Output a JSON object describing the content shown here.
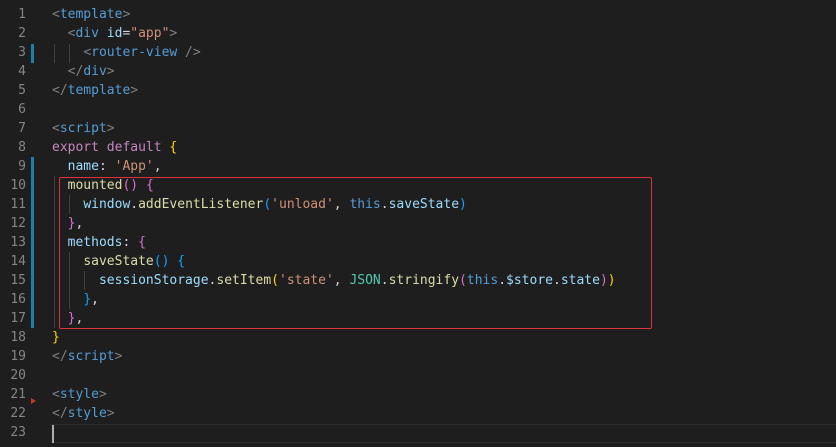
{
  "editor": {
    "lines": [
      {
        "n": "1",
        "tokens": [
          {
            "t": "<",
            "c": "#808080"
          },
          {
            "t": "template",
            "c": "#569cd6"
          },
          {
            "t": ">",
            "c": "#808080"
          }
        ]
      },
      {
        "n": "2",
        "tokens": [
          {
            "t": "  ",
            "c": "#d4d4d4"
          },
          {
            "t": "<",
            "c": "#808080"
          },
          {
            "t": "div",
            "c": "#569cd6"
          },
          {
            "t": " ",
            "c": "#d4d4d4"
          },
          {
            "t": "id",
            "c": "#9cdcfe"
          },
          {
            "t": "=",
            "c": "#d4d4d4"
          },
          {
            "t": "\"app\"",
            "c": "#ce9178"
          },
          {
            "t": ">",
            "c": "#808080"
          }
        ]
      },
      {
        "n": "3",
        "tokens": [
          {
            "t": "    ",
            "c": "#d4d4d4"
          },
          {
            "t": "<",
            "c": "#808080"
          },
          {
            "t": "router-view",
            "c": "#569cd6"
          },
          {
            "t": " />",
            "c": "#808080"
          }
        ]
      },
      {
        "n": "4",
        "tokens": [
          {
            "t": "  ",
            "c": "#d4d4d4"
          },
          {
            "t": "</",
            "c": "#808080"
          },
          {
            "t": "div",
            "c": "#569cd6"
          },
          {
            "t": ">",
            "c": "#808080"
          }
        ]
      },
      {
        "n": "5",
        "tokens": [
          {
            "t": "</",
            "c": "#808080"
          },
          {
            "t": "template",
            "c": "#569cd6"
          },
          {
            "t": ">",
            "c": "#808080"
          }
        ]
      },
      {
        "n": "6",
        "tokens": []
      },
      {
        "n": "7",
        "tokens": [
          {
            "t": "<",
            "c": "#808080"
          },
          {
            "t": "script",
            "c": "#569cd6"
          },
          {
            "t": ">",
            "c": "#808080"
          }
        ]
      },
      {
        "n": "8",
        "tokens": [
          {
            "t": "export",
            "c": "#c586c0"
          },
          {
            "t": " ",
            "c": "#d4d4d4"
          },
          {
            "t": "default",
            "c": "#c586c0"
          },
          {
            "t": " ",
            "c": "#d4d4d4"
          },
          {
            "t": "{",
            "c": "#ffd700"
          }
        ]
      },
      {
        "n": "9",
        "tokens": [
          {
            "t": "  ",
            "c": "#d4d4d4"
          },
          {
            "t": "name",
            "c": "#9cdcfe"
          },
          {
            "t": ": ",
            "c": "#d4d4d4"
          },
          {
            "t": "'App'",
            "c": "#ce9178"
          },
          {
            "t": ",",
            "c": "#d4d4d4"
          }
        ]
      },
      {
        "n": "10",
        "tokens": [
          {
            "t": "  ",
            "c": "#d4d4d4"
          },
          {
            "t": "mounted",
            "c": "#dcdcaa"
          },
          {
            "t": "()",
            "c": "#da70d6"
          },
          {
            "t": " ",
            "c": "#d4d4d4"
          },
          {
            "t": "{",
            "c": "#da70d6"
          }
        ]
      },
      {
        "n": "11",
        "tokens": [
          {
            "t": "    ",
            "c": "#d4d4d4"
          },
          {
            "t": "window",
            "c": "#9cdcfe"
          },
          {
            "t": ".",
            "c": "#d4d4d4"
          },
          {
            "t": "addEventListener",
            "c": "#dcdcaa"
          },
          {
            "t": "(",
            "c": "#179fff"
          },
          {
            "t": "'unload'",
            "c": "#ce9178"
          },
          {
            "t": ", ",
            "c": "#d4d4d4"
          },
          {
            "t": "this",
            "c": "#569cd6"
          },
          {
            "t": ".",
            "c": "#d4d4d4"
          },
          {
            "t": "saveState",
            "c": "#9cdcfe"
          },
          {
            "t": ")",
            "c": "#179fff"
          }
        ]
      },
      {
        "n": "12",
        "tokens": [
          {
            "t": "  ",
            "c": "#d4d4d4"
          },
          {
            "t": "}",
            "c": "#da70d6"
          },
          {
            "t": ",",
            "c": "#d4d4d4"
          }
        ]
      },
      {
        "n": "13",
        "tokens": [
          {
            "t": "  ",
            "c": "#d4d4d4"
          },
          {
            "t": "methods",
            "c": "#9cdcfe"
          },
          {
            "t": ": ",
            "c": "#d4d4d4"
          },
          {
            "t": "{",
            "c": "#da70d6"
          }
        ]
      },
      {
        "n": "14",
        "tokens": [
          {
            "t": "    ",
            "c": "#d4d4d4"
          },
          {
            "t": "saveState",
            "c": "#dcdcaa"
          },
          {
            "t": "()",
            "c": "#179fff"
          },
          {
            "t": " ",
            "c": "#d4d4d4"
          },
          {
            "t": "{",
            "c": "#179fff"
          }
        ]
      },
      {
        "n": "15",
        "tokens": [
          {
            "t": "      ",
            "c": "#d4d4d4"
          },
          {
            "t": "sessionStorage",
            "c": "#9cdcfe"
          },
          {
            "t": ".",
            "c": "#d4d4d4"
          },
          {
            "t": "setItem",
            "c": "#dcdcaa"
          },
          {
            "t": "(",
            "c": "#ffd700"
          },
          {
            "t": "'state'",
            "c": "#ce9178"
          },
          {
            "t": ", ",
            "c": "#d4d4d4"
          },
          {
            "t": "JSON",
            "c": "#4ec9b0"
          },
          {
            "t": ".",
            "c": "#d4d4d4"
          },
          {
            "t": "stringify",
            "c": "#dcdcaa"
          },
          {
            "t": "(",
            "c": "#da70d6"
          },
          {
            "t": "this",
            "c": "#569cd6"
          },
          {
            "t": ".",
            "c": "#d4d4d4"
          },
          {
            "t": "$store",
            "c": "#9cdcfe"
          },
          {
            "t": ".",
            "c": "#d4d4d4"
          },
          {
            "t": "state",
            "c": "#9cdcfe"
          },
          {
            "t": ")",
            "c": "#da70d6"
          },
          {
            "t": ")",
            "c": "#ffd700"
          }
        ]
      },
      {
        "n": "16",
        "tokens": [
          {
            "t": "    ",
            "c": "#d4d4d4"
          },
          {
            "t": "}",
            "c": "#179fff"
          },
          {
            "t": ",",
            "c": "#d4d4d4"
          }
        ]
      },
      {
        "n": "17",
        "tokens": [
          {
            "t": "  ",
            "c": "#d4d4d4"
          },
          {
            "t": "}",
            "c": "#da70d6"
          },
          {
            "t": ",",
            "c": "#d4d4d4"
          }
        ]
      },
      {
        "n": "18",
        "tokens": [
          {
            "t": "}",
            "c": "#ffd700"
          }
        ]
      },
      {
        "n": "19",
        "tokens": [
          {
            "t": "</",
            "c": "#808080"
          },
          {
            "t": "script",
            "c": "#569cd6"
          },
          {
            "t": ">",
            "c": "#808080"
          }
        ]
      },
      {
        "n": "20",
        "tokens": []
      },
      {
        "n": "21",
        "tokens": [
          {
            "t": "<",
            "c": "#808080"
          },
          {
            "t": "style",
            "c": "#569cd6"
          },
          {
            "t": ">",
            "c": "#808080"
          }
        ]
      },
      {
        "n": "22",
        "tokens": [
          {
            "t": "</",
            "c": "#808080"
          },
          {
            "t": "style",
            "c": "#569cd6"
          },
          {
            "t": ">",
            "c": "#808080"
          }
        ]
      },
      {
        "n": "23",
        "tokens": []
      }
    ],
    "fold_marker_icon": "breakpoint-arrow-icon",
    "highlight_color": "#e0323c",
    "modified_bar_color": "#1b81a8"
  }
}
